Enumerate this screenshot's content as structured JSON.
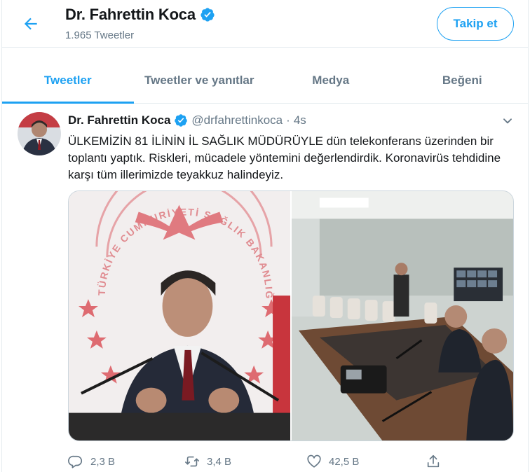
{
  "header": {
    "name": "Dr. Fahrettin Koca",
    "tweet_count": "1.965 Tweetler",
    "follow_label": "Takip et"
  },
  "tabs": [
    {
      "label": "Tweetler",
      "active": true
    },
    {
      "label": "Tweetler ve yanıtlar",
      "active": false
    },
    {
      "label": "Medya",
      "active": false
    },
    {
      "label": "Beğeni",
      "active": false
    }
  ],
  "tweet": {
    "author_name": "Dr. Fahrettin Koca",
    "handle": "@drfahrettinkoca",
    "separator": "·",
    "time": "4s",
    "text": "ÜLKEMİZİN 81 İLİNİN İL SAĞLIK MÜDÜRÜYLE dün telekonferans üzerinden bir toplantı yaptık. Riskleri, mücadele yöntemini değerlendirdik. Koronavirüs tehdidine karşı tüm illerimizde teyakkuz halindeyiz.",
    "photo_logo_text": "TÜRKİYE CUMHURİYETİ SAĞLIK BAKANLIĞI",
    "actions": {
      "reply_count": "2,3 B",
      "retweet_count": "3,4 B",
      "like_count": "42,5 B"
    }
  },
  "colors": {
    "accent": "#1da1f2",
    "secondary_text": "#657786",
    "border": "#e6ecf0",
    "logo_red": "#d9434a"
  },
  "icons": [
    "back-arrow-icon",
    "verified-badge-icon",
    "chevron-down-icon",
    "reply-icon",
    "retweet-icon",
    "like-icon",
    "share-icon"
  ]
}
